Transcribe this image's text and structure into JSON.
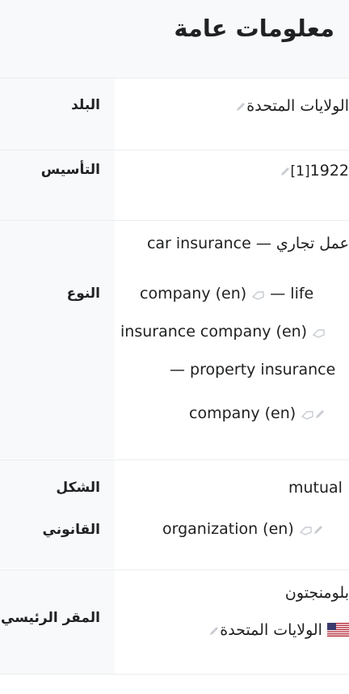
{
  "infobox": {
    "title": "معلومات عامة",
    "rows": [
      {
        "label": "البلد",
        "value": "الولايات المتحدة"
      },
      {
        "label": "التأسيس",
        "value": "1922",
        "ref": "[1]"
      },
      {
        "label": "النوع",
        "prefix": "عمل تجاري",
        "dash": "—",
        "items": [
          "car insurance company (en)",
          "life insurance company (en)",
          "property insurance company (en)"
        ]
      },
      {
        "label_line1": "الشكل",
        "label_line2": "القانوني",
        "value": "mutual organization (en)"
      },
      {
        "label": "المقر الرئيسي",
        "city": "بلومنجتون",
        "country": "الولايات المتحدة"
      }
    ]
  },
  "icons": {
    "edit": "pencil-icon",
    "wikidata_tag": "tag-icon",
    "flag": "us-flag-icon"
  },
  "colors": {
    "header_bg": "#f8f9fa",
    "separator": "#eaecf0",
    "icon_gray": "#c8ccd1"
  }
}
